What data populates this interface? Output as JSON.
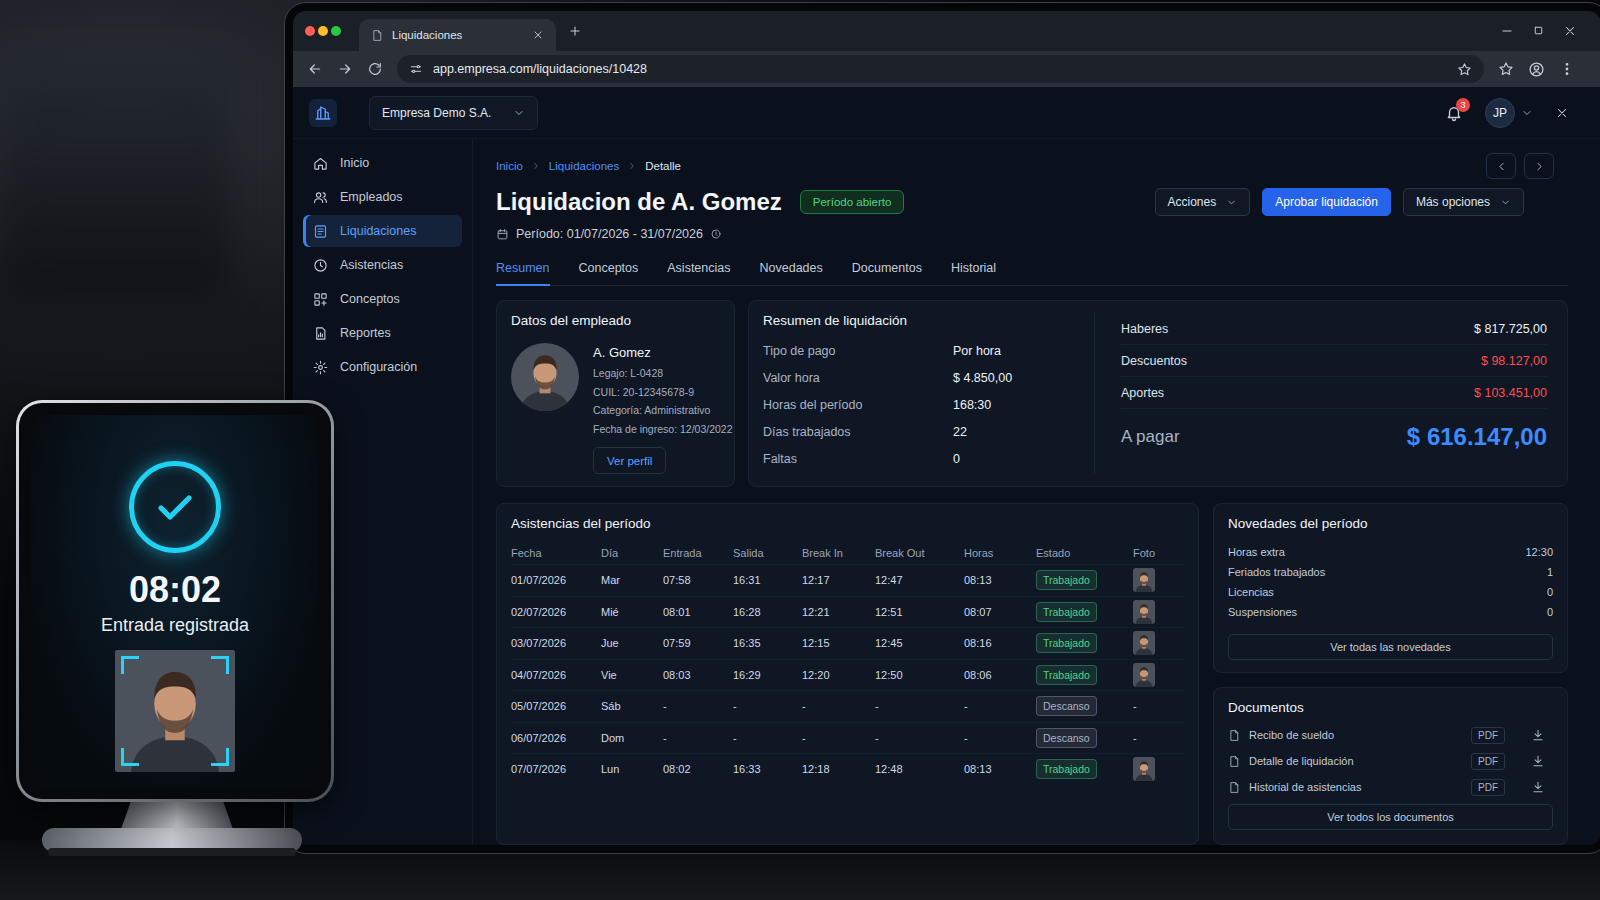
{
  "browser": {
    "tab_title": "Liquidaciones",
    "url": "app.empresa.com/liquidaciones/10428"
  },
  "app_header": {
    "company": "Empresa Demo S.A.",
    "notifications": "3",
    "user_initials": "JP"
  },
  "sidebar": {
    "items": [
      {
        "label": "Inicio",
        "selected": false
      },
      {
        "label": "Empleados",
        "selected": false
      },
      {
        "label": "Liquidaciones",
        "selected": true
      },
      {
        "label": "Asistencias",
        "selected": false
      },
      {
        "label": "Conceptos",
        "selected": false
      },
      {
        "label": "Reportes",
        "selected": false
      },
      {
        "label": "Configuración",
        "selected": false
      }
    ]
  },
  "breadcrumb": [
    {
      "label": "Inicio",
      "current": false
    },
    {
      "label": "Liquidaciones",
      "current": false
    },
    {
      "label": "Detalle",
      "current": true
    }
  ],
  "page": {
    "title": "Liquidacion de A. Gomez",
    "status": "Período abierto",
    "period": "Período: 01/07/2026 - 31/07/2026",
    "actions": [
      {
        "label": "Acciones",
        "kind": "dropdown"
      },
      {
        "label": "Aprobar liquidación",
        "kind": "primary"
      },
      {
        "label": "Más opciones",
        "kind": "dropdown"
      }
    ]
  },
  "tabs": [
    {
      "label": "Resumen",
      "selected": true
    },
    {
      "label": "Conceptos",
      "selected": false
    },
    {
      "label": "Asistencias",
      "selected": false
    },
    {
      "label": "Novedades",
      "selected": false
    },
    {
      "label": "Documentos",
      "selected": false
    },
    {
      "label": "Historial",
      "selected": false
    }
  ],
  "employee": {
    "card_title": "Datos del empleado",
    "name": "A. Gomez",
    "fields": [
      "Legajo: L-0428",
      "CUIL: 20-12345678-9",
      "Categoría: Administrativo",
      "Fecha de ingreso: 12/03/2022"
    ],
    "button": "Ver perfil"
  },
  "summary": {
    "title": "Resumen de liquidación",
    "details": [
      {
        "label": "Tipo de pago",
        "value": "Por hora"
      },
      {
        "label": "Valor hora",
        "value": "$ 4.850,00"
      },
      {
        "label": "Horas del período",
        "value": "168:30"
      },
      {
        "label": "Días trabajados",
        "value": "22"
      },
      {
        "label": "Faltas",
        "value": "0"
      }
    ],
    "totals": [
      {
        "label": "Haberes",
        "value": "$ 817.725,00",
        "color": "#eef2f7"
      },
      {
        "label": "Descuentos",
        "value": "$ 98.127,00",
        "color": "#ff4d4f"
      },
      {
        "label": "Aportes",
        "value": "$ 103.451,00",
        "color": "#ff4d4f"
      }
    ],
    "net": {
      "label": "A pagar",
      "value": "$ 616.147,00"
    }
  },
  "attendance": {
    "title": "Asistencias del período",
    "columns": [
      "Fecha",
      "Día",
      "Entrada",
      "Salida",
      "Break In",
      "Break Out",
      "Horas",
      "Estado",
      "Foto"
    ],
    "rows": [
      {
        "cells": [
          "01/07/2026",
          "Mar",
          "07:58",
          "16:31",
          "12:17",
          "12:47",
          "08:13"
        ],
        "status": "Trabajado",
        "color": "#4fd585",
        "photo": true
      },
      {
        "cells": [
          "02/07/2026",
          "Mié",
          "08:01",
          "16:28",
          "12:21",
          "12:51",
          "08:07"
        ],
        "status": "Trabajado",
        "color": "#4fd585",
        "photo": true
      },
      {
        "cells": [
          "03/07/2026",
          "Jue",
          "07:59",
          "16:35",
          "12:15",
          "12:45",
          "08:16"
        ],
        "status": "Trabajado",
        "color": "#4fd585",
        "photo": true
      },
      {
        "cells": [
          "04/07/2026",
          "Vie",
          "08:03",
          "16:29",
          "12:20",
          "12:50",
          "08:06"
        ],
        "status": "Trabajado",
        "color": "#4fd585",
        "photo": true
      },
      {
        "cells": [
          "05/07/2026",
          "Sáb",
          "-",
          "-",
          "-",
          "-",
          "-"
        ],
        "status": "Descanso",
        "color": "#aab4c3",
        "photo": false,
        "foto_text": "-"
      },
      {
        "cells": [
          "06/07/2026",
          "Dom",
          "-",
          "-",
          "-",
          "-",
          "-"
        ],
        "status": "Descanso",
        "color": "#aab4c3",
        "photo": false,
        "foto_text": "-"
      },
      {
        "cells": [
          "07/07/2026",
          "Lun",
          "08:02",
          "16:33",
          "12:18",
          "12:48",
          "08:13"
        ],
        "status": "Trabajado",
        "color": "#4fd585",
        "photo": true
      }
    ]
  },
  "news": {
    "title": "Novedades del período",
    "items": [
      {
        "label": "Horas extra",
        "value": "12:30"
      },
      {
        "label": "Feriados trabajados",
        "value": "1"
      },
      {
        "label": "Licencias",
        "value": "0"
      },
      {
        "label": "Suspensiones",
        "value": "0"
      }
    ],
    "button": "Ver todas las novedades"
  },
  "documents": {
    "title": "Documentos",
    "items": [
      {
        "label": "Recibo de sueldo",
        "format": "PDF"
      },
      {
        "label": "Detalle de liquidación",
        "format": "PDF"
      },
      {
        "label": "Historial de asistencias",
        "format": "PDF"
      }
    ],
    "button": "Ver todos los documentos"
  },
  "kiosk": {
    "time": "08:02",
    "message": "Entrada registrada"
  }
}
